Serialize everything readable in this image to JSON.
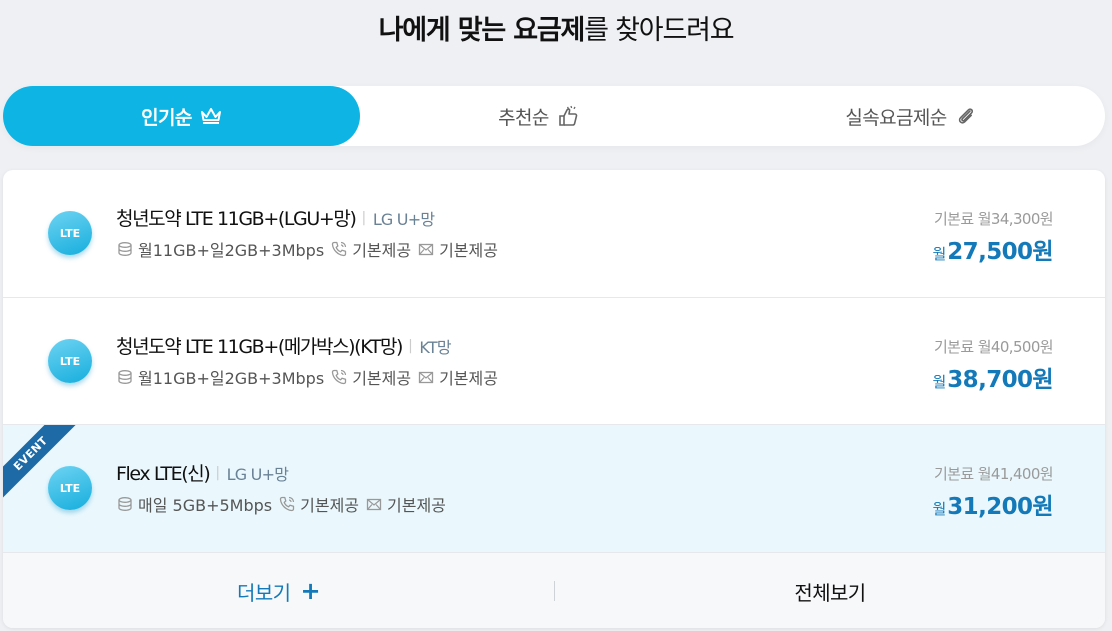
{
  "header": {
    "title_bold": "나에게 맞는 요금제",
    "title_rest": "를 찾아드려요"
  },
  "tabs": [
    {
      "label": "인기순",
      "icon": "crown-icon",
      "active": true
    },
    {
      "label": "추천순",
      "icon": "thumbs-up-icon",
      "active": false
    },
    {
      "label": "실속요금제순",
      "icon": "paperclip-icon",
      "active": false
    }
  ],
  "plans": [
    {
      "badge": "LTE",
      "name": "청년도약 LTE 11GB+(LGU+망)",
      "network": "LG U+망",
      "data": "월11GB+일2GB+3Mbps",
      "voice": "기본제공",
      "sms": "기본제공",
      "base_price": "기본료 월34,300원",
      "price_prefix": "월",
      "price": "27,500원",
      "event": false
    },
    {
      "badge": "LTE",
      "name": "청년도약 LTE 11GB+(메가박스)(KT망)",
      "network": "KT망",
      "data": "월11GB+일2GB+3Mbps",
      "voice": "기본제공",
      "sms": "기본제공",
      "base_price": "기본료 월40,500원",
      "price_prefix": "월",
      "price": "38,700원",
      "event": false
    },
    {
      "badge": "LTE",
      "name": "Flex LTE(신)",
      "network": "LG U+망",
      "data": "매일 5GB+5Mbps",
      "voice": "기본제공",
      "sms": "기본제공",
      "base_price": "기본료 월41,400원",
      "price_prefix": "월",
      "price": "31,200원",
      "event": true,
      "event_label": "EVENT"
    }
  ],
  "footer": {
    "more_label": "더보기",
    "more_icon": "+",
    "all_label": "전체보기"
  },
  "colors": {
    "accent": "#0db4e4",
    "price": "#1479b8",
    "event_row_bg": "#eaf8fd",
    "event_ribbon": "#1e6aa6"
  }
}
